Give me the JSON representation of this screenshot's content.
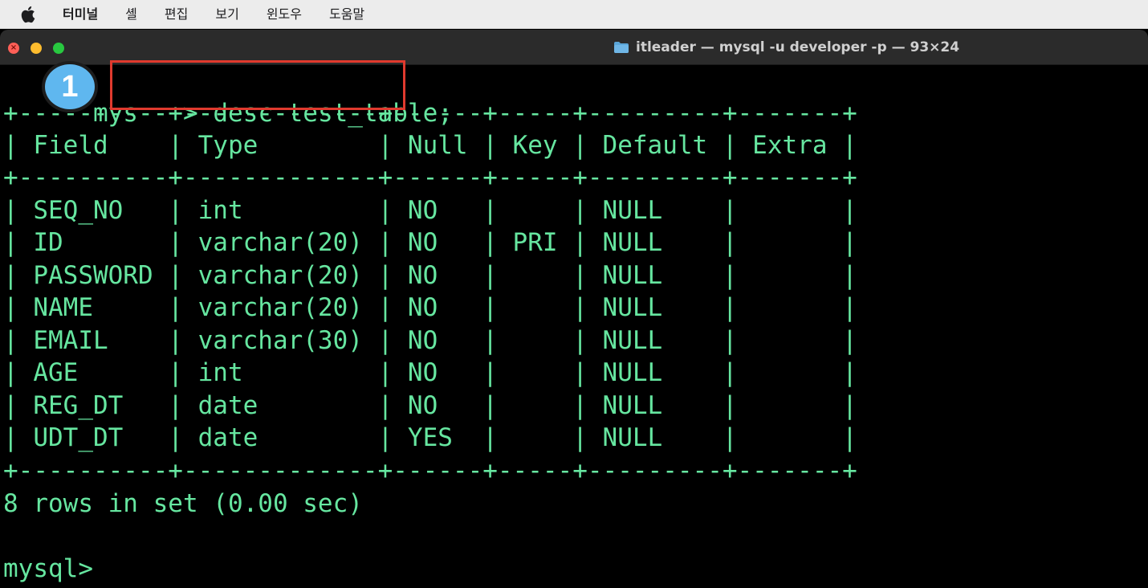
{
  "menubar": {
    "app_name": "터미널",
    "items": [
      "셸",
      "편집",
      "보기",
      "윈도우",
      "도움말"
    ]
  },
  "window": {
    "title": "itleader — mysql -u developer -p — 93×24"
  },
  "terminal": {
    "prompt_partial": "mys",
    "prompt_arrow": ">",
    "command": "desc test_table;",
    "table_border": "+----------+-------------+------+-----+---------+-------+",
    "header_row": "| Field    | Type        | Null | Key | Default | Extra |",
    "rows": [
      "| SEQ_NO   | int         | NO   |     | NULL    |       |",
      "| ID       | varchar(20) | NO   | PRI | NULL    |       |",
      "| PASSWORD | varchar(20) | NO   |     | NULL    |       |",
      "| NAME     | varchar(20) | NO   |     | NULL    |       |",
      "| EMAIL    | varchar(30) | NO   |     | NULL    |       |",
      "| AGE      | int         | NO   |     | NULL    |       |",
      "| REG_DT   | date        | NO   |     | NULL    |       |",
      "| UDT_DT   | date        | YES  |     | NULL    |       |"
    ],
    "result_summary": "8 rows in set (0.00 sec)",
    "final_prompt": "mysql>"
  },
  "annotation": {
    "step_number": "1",
    "highlight_color": "#e03a2e",
    "badge_color": "#5fb7ef"
  },
  "colors": {
    "terminal_text": "#66e6a0",
    "terminal_bg": "#000000"
  }
}
